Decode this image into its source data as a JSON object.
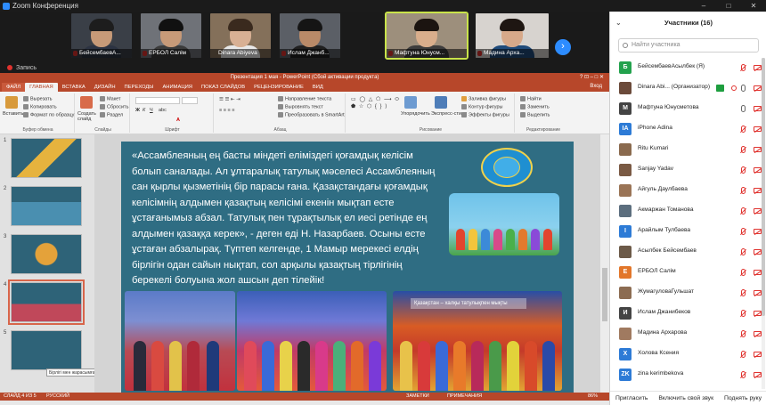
{
  "app": {
    "title": "Zoom Конференция",
    "controls": {
      "minimize": "–",
      "maximize": "□",
      "close": "✕"
    }
  },
  "video_strip": {
    "tiles": [
      {
        "name": "БейсембаевА...",
        "active": false
      },
      {
        "name": "ЕРБОЛ Салім",
        "active": false
      },
      {
        "name": "Dinara Abiyeva",
        "active": false
      },
      {
        "name": "Ислам Джанб...",
        "active": false
      },
      {
        "name": "Мафтуна Юнусм...",
        "active": true
      },
      {
        "name": "Мадина Арха...",
        "active": false
      }
    ],
    "next_icon": "›"
  },
  "recording": {
    "label": "Запись"
  },
  "powerpoint": {
    "title": "Презентация 1 мая - PowerPoint (Сбой активации продукта)",
    "title_controls": "? ⊡ – □ ✕",
    "user": "Вход",
    "tabs": [
      "ФАЙЛ",
      "ГЛАВНАЯ",
      "ВСТАВКА",
      "ДИЗАЙН",
      "ПЕРЕХОДЫ",
      "АНИМАЦИЯ",
      "ПОКАЗ СЛАЙДОВ",
      "РЕЦЕНЗИРОВАНИЕ",
      "ВИД"
    ],
    "ribbon": {
      "paste": "Вставить",
      "cut": "Вырезать",
      "copy": "Копировать",
      "format_painter": "Формат по образцу",
      "clipboard_group": "Буфер обмена",
      "new_slide": "Создать слайд",
      "layout": "Макет",
      "reset": "Сбросить",
      "section": "Раздел",
      "slides_group": "Слайды",
      "font_group": "Шрифт",
      "text_direction": "Направление текста",
      "align_text": "Выровнять текст",
      "convert_smartart": "Преобразовать в SmartArt",
      "paragraph_group": "Абзац",
      "arrange": "Упорядочить",
      "quick_styles": "Экспресс-стили",
      "shape_fill": "Заливка фигуры",
      "shape_outline": "Контур фигуры",
      "shape_effects": "Эффекты фигуры",
      "drawing_group": "Рисование",
      "find": "Найти",
      "replace": "Заменить",
      "select": "Выделить",
      "editing_group": "Редактирование"
    },
    "slide_numbers": [
      "1",
      "2",
      "3",
      "4",
      "5"
    ],
    "selected_slide": 4,
    "tooltip": "Бірлігі мен жарасымға, жалғасқа тағына...",
    "slide_text": "«Ассамблеяның ең басты міндеті еліміздегі қоғамдық келісім болып саналады. Ал ұлтаралық татулық мәселесі Ассамблеяның сан қырлы қызметінің бір парасы ғана. Қазақстандағы қоғамдық келісімнің алдымен қазақтың келісімі екенін мықтап есте ұстағанымыз абзал. Татулық пен тұрақтылық ел иесі ретінде ең алдымен қазаққа керек», - деген еді Н. Назарбаев. Осыны есте ұстаған абзалырақ. Түптеп келгенде, 1 Мамыр мерекесі елдің бірлігін одан сайын нықтап, сол арқылы қазақтың тірлігінің берекелі болуына жол ашсын деп тілейік!",
    "photo3_banner": "Қазақстан – халқы татулықпен мықты",
    "status": {
      "slide": "СЛАЙД 4 ИЗ 5",
      "language": "РУССКИЙ",
      "notes": "ЗАМЕТКИ",
      "comments": "ПРИМЕЧАНИЯ",
      "zoom": "86%"
    }
  },
  "participants": {
    "title": "Участники (16)",
    "search_placeholder": "Найти участника",
    "list": [
      {
        "initial": "Б",
        "color": "#23a24d",
        "name": "БейсембаевАсылбек (Я)",
        "mic": "off",
        "cam": "off"
      },
      {
        "initial": "",
        "color": "#6b4a3a",
        "name": "Dinara Abi... (Организатор)",
        "mic": "on",
        "cam": "off",
        "host": true
      },
      {
        "initial": "М",
        "color": "#444444",
        "name": "Мафтуна Юнусметова",
        "mic": "on",
        "cam": "off"
      },
      {
        "initial": "IA",
        "color": "#2d7bd6",
        "name": "iPhone Adina",
        "mic": "off",
        "cam": "off"
      },
      {
        "initial": "",
        "color": "#8a6a4e",
        "name": "Ritu Kumari",
        "mic": "off",
        "cam": "off"
      },
      {
        "initial": "",
        "color": "#7a5a44",
        "name": "Sanjay Yadav",
        "mic": "off",
        "cam": "off"
      },
      {
        "initial": "",
        "color": "#9a7456",
        "name": "Айгуль Даулбаева",
        "mic": "off",
        "cam": "off"
      },
      {
        "initial": "",
        "color": "#5c6e7e",
        "name": "Акмаржан Томанова",
        "mic": "off",
        "cam": "off"
      },
      {
        "initial": "I",
        "color": "#2d7bd6",
        "name": "Арайлым Тулбаева",
        "mic": "off",
        "cam": "off"
      },
      {
        "initial": "",
        "color": "#6c5a48",
        "name": "Асылбек Бейсембаев",
        "mic": "off",
        "cam": "off"
      },
      {
        "initial": "E",
        "color": "#e2762a",
        "name": "ЕРБОЛ Салім",
        "mic": "off",
        "cam": "off"
      },
      {
        "initial": "",
        "color": "#8c6c52",
        "name": "ЖумагуловаГульшат",
        "mic": "off",
        "cam": "off"
      },
      {
        "initial": "И",
        "color": "#444444",
        "name": "Ислам Джанибеков",
        "mic": "off",
        "cam": "off"
      },
      {
        "initial": "",
        "color": "#a07a60",
        "name": "Мадина Архарова",
        "mic": "off",
        "cam": "off"
      },
      {
        "initial": "X",
        "color": "#2d7bd6",
        "name": "Холова Ксения",
        "mic": "off",
        "cam": "off"
      },
      {
        "initial": "ZK",
        "color": "#2d7bd6",
        "name": "zina kerimbekova",
        "mic": "off",
        "cam": "off"
      }
    ],
    "footer": {
      "invite": "Пригласить",
      "unmute": "Включить свой звук",
      "raise_hand": "Поднять руку"
    }
  }
}
